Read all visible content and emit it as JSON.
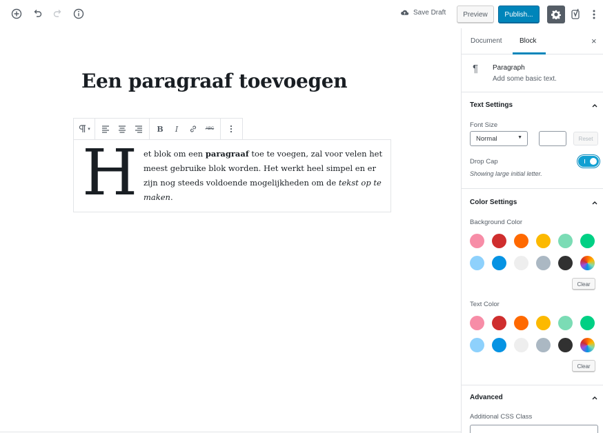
{
  "header": {
    "save_draft": "Save Draft",
    "preview": "Preview",
    "publish": "Publish...",
    "icons": [
      "plus-circle-icon",
      "undo-icon",
      "redo-icon",
      "info-icon",
      "cloud-icon",
      "gear-icon",
      "yoast-icon",
      "more-vertical-icon"
    ]
  },
  "editor": {
    "title": "Een paragraaf toevoegen",
    "drop_cap_letter": "H",
    "paragraph": {
      "t1": "et blok om een ",
      "bold": "paragraaf",
      "t2": " toe te voegen, zal voor velen het meest gebruike blok worden. Het werkt heel simpel en er zijn nog steeds voldoende mogelijkheden om de ",
      "italic": "tekst op te maken",
      "t3": "."
    },
    "toolbar": {
      "bold": "B",
      "italic": "I",
      "strikethrough": "ABC"
    }
  },
  "sidebar": {
    "tabs": [
      "Document",
      "Block"
    ],
    "active_tab": "Block",
    "block": {
      "name": "Paragraph",
      "description": "Add some basic text."
    },
    "text_settings": {
      "title": "Text Settings",
      "font_size_label": "Font Size",
      "font_size_value": "Normal",
      "reset": "Reset",
      "drop_cap_label": "Drop Cap",
      "drop_cap_on": true,
      "drop_cap_help": "Showing large initial letter."
    },
    "color_settings": {
      "title": "Color Settings",
      "background_label": "Background Color",
      "text_label": "Text Color",
      "clear": "Clear",
      "palette": [
        "#f78da7",
        "#cf2e2e",
        "#ff6900",
        "#fcb900",
        "#7bdcb5",
        "#00d084",
        "#8ed1fc",
        "#0693e3",
        "#eeeeee",
        "#abb8c3",
        "#313131",
        "gradient"
      ]
    },
    "advanced": {
      "title": "Advanced",
      "css_class_label": "Additional CSS Class"
    }
  }
}
